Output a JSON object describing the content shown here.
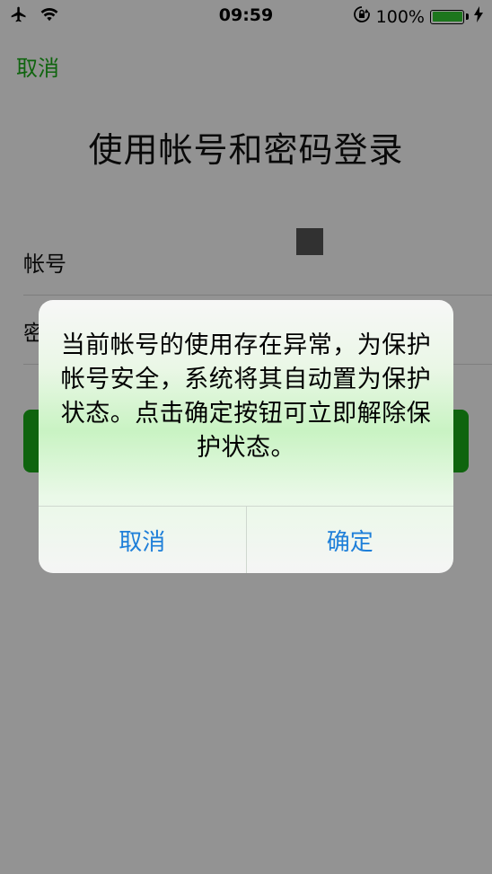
{
  "status_bar": {
    "airplane_icon": "airplane-icon",
    "wifi_icon": "wifi-icon",
    "time": "09:59",
    "orientation_lock_icon": "orientation-lock-icon",
    "battery_percent": "100%",
    "battery_level": 1.0,
    "charging_icon": "bolt-icon"
  },
  "nav": {
    "cancel_label": "取消"
  },
  "page": {
    "title": "使用帐号和密码登录",
    "account_label": "帐号",
    "password_label": "密",
    "login_button_label": ""
  },
  "alert": {
    "message": "当前帐号的使用存在异常，为保护帐号安全，系统将其自动置为保护状态。点击确定按钮可立即解除保护状态。",
    "cancel_label": "取消",
    "confirm_label": "确定"
  },
  "colors": {
    "accent_green": "#1aad19",
    "alert_button_blue": "#1e7fd9"
  }
}
